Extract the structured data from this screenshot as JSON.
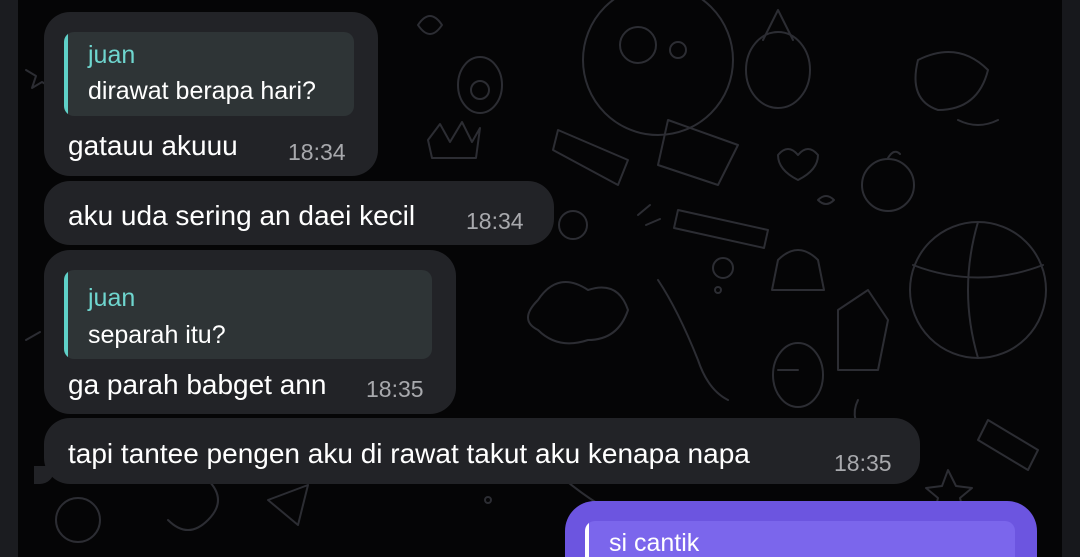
{
  "messages": [
    {
      "reply": {
        "author": "juan",
        "text": "dirawat berapa hari?"
      },
      "text": "gatauu akuuu",
      "time": "18:34"
    },
    {
      "text": "aku uda sering an daei kecil",
      "time": "18:34"
    },
    {
      "reply": {
        "author": "juan",
        "text": "separah itu?"
      },
      "text": "ga parah babget ann",
      "time": "18:35"
    },
    {
      "text": "tapi tantee pengen aku di rawat takut aku kenapa napa",
      "time": "18:35"
    }
  ],
  "outgoing": {
    "reply": {
      "author": "si cantik"
    }
  },
  "colors": {
    "incoming_bubble": "#222327",
    "reply_accent": "#5fd0c8",
    "outgoing_bubble": "#6c55e0",
    "background": "#050506"
  }
}
